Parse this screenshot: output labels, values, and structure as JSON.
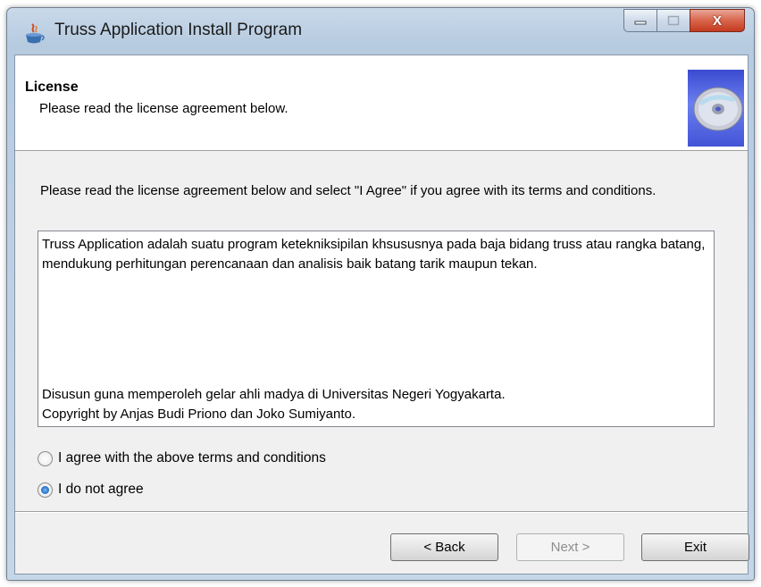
{
  "window": {
    "title": "Truss Application Install Program",
    "close_glyph": "X"
  },
  "header": {
    "title": "License",
    "subtitle": "Please read the license agreement below."
  },
  "intro_text": "Please read the license agreement below and select \"I Agree\" if you agree with its terms and conditions.",
  "license": {
    "paragraph1": "Truss Application adalah suatu program ketekniksipilan khsususnya pada baja bidang truss atau rangka batang, mendukung perhitungan perencanaan dan analisis baik batang tarik maupun tekan.",
    "line2": "Disusun guna memperoleh gelar ahli madya di Universitas Negeri Yogyakarta.",
    "line3": "Copyright by Anjas Budi Priono dan Joko Sumiyanto."
  },
  "options": {
    "agree_label": "I agree with the above terms and conditions",
    "disagree_label": "I do not agree",
    "selected": "disagree"
  },
  "buttons": {
    "back": "< Back",
    "next": "Next >",
    "exit": "Exit"
  },
  "colors": {
    "close_button": "#c9482d",
    "client_bg": "#f0f0f0",
    "header_bg": "#ffffff"
  }
}
